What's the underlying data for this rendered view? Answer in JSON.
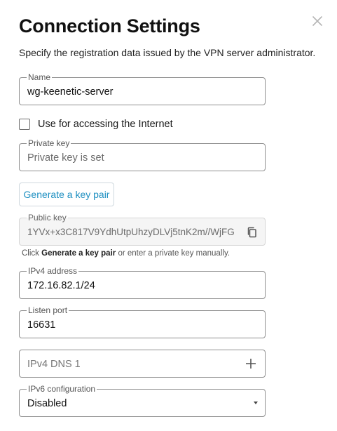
{
  "dialog": {
    "title": "Connection Settings",
    "subtitle": "Specify the registration data issued by the VPN server administrator."
  },
  "fields": {
    "name": {
      "label": "Name",
      "value": "wg-keenetic-server"
    },
    "internet_checkbox": {
      "label": "Use for accessing the Internet",
      "checked": false
    },
    "private_key": {
      "label": "Private key",
      "value": "Private key is set"
    },
    "generate_button": "Generate a key pair",
    "public_key": {
      "label": "Public key",
      "value": "1YVx+x3C817V9YdhUtpUhzyDLVj5tnK2m//WjFG"
    },
    "hint": {
      "prefix": "Click ",
      "bold": "Generate a key pair",
      "suffix": " or enter a private key manually."
    },
    "ipv4_address": {
      "label": "IPv4 address",
      "value": "172.16.82.1/24"
    },
    "listen_port": {
      "label": "Listen port",
      "value": "16631"
    },
    "ipv4_dns": {
      "placeholder": "IPv4 DNS 1"
    },
    "ipv6_config": {
      "label": "IPv6 configuration",
      "value": "Disabled"
    }
  },
  "icons": {
    "close": "close-icon",
    "copy": "copy-icon",
    "add": "plus-icon",
    "dropdown": "caret-down-icon"
  },
  "colors": {
    "accent": "#1d8fc1",
    "border": "#8f8f8f",
    "disabled_bg": "#f5f5f5"
  }
}
